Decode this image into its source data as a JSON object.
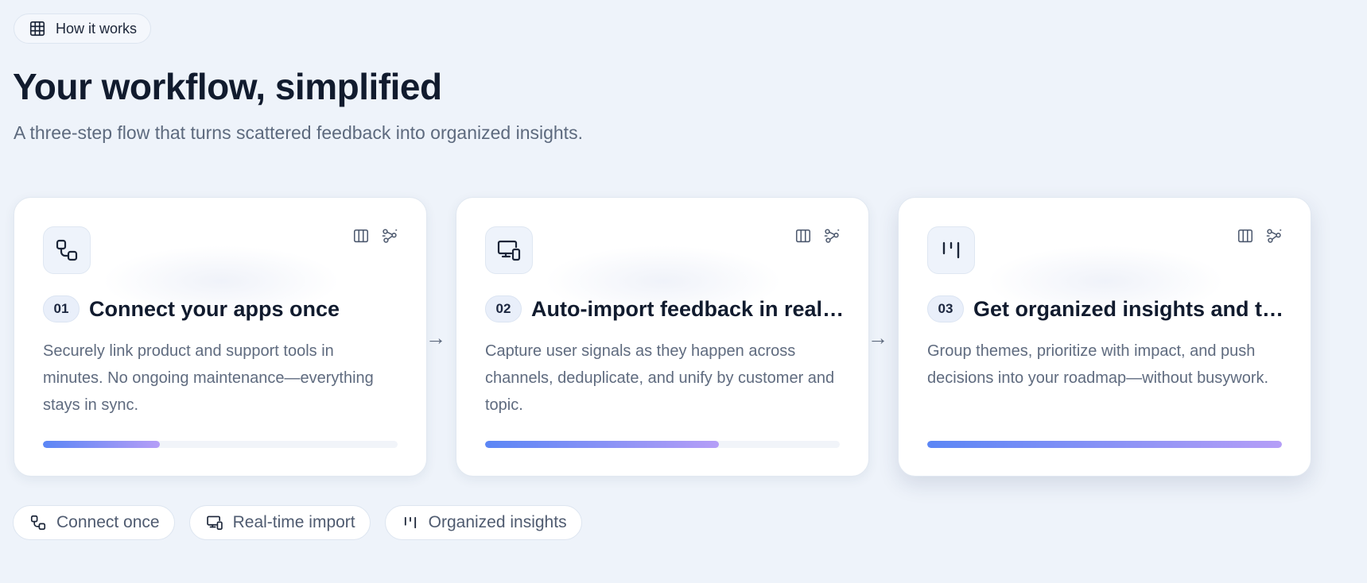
{
  "eyebrow": {
    "label": "How it works",
    "icon": "grid-icon"
  },
  "header": {
    "title": "Your workflow, simplified",
    "subtitle": "A three-step flow that turns scattered feedback into organized insights."
  },
  "colors": {
    "background": "#eef3fa",
    "accent_start": "#5b86f5",
    "accent_end": "#b59ef7",
    "heading": "#111b2e",
    "muted": "#5d6a7e"
  },
  "steps": [
    {
      "number": "01",
      "title": "Connect your apps once",
      "description": "Securely link product and support tools in minutes. No ongoing maintenance—everything stays in sync.",
      "icon": "connect-icon",
      "progress": 0.33
    },
    {
      "number": "02",
      "title": "Auto-import feedback in real time",
      "description": "Capture user signals as they happen across channels, deduplicate, and unify by customer and topic.",
      "icon": "monitor-sync-icon",
      "progress": 0.66
    },
    {
      "number": "03",
      "title": "Get organized insights and take action",
      "description": "Group themes, prioritize with impact, and push decisions into your roadmap—without busywork.",
      "icon": "kanban-icon",
      "progress": 1.0
    }
  ],
  "card_tools": [
    "columns-icon",
    "workflow-icon"
  ],
  "arrow_glyph": "→",
  "chips": [
    {
      "label": "Connect once",
      "icon": "connect-icon"
    },
    {
      "label": "Real-time import",
      "icon": "monitor-sync-icon"
    },
    {
      "label": "Organized insights",
      "icon": "kanban-icon"
    }
  ]
}
